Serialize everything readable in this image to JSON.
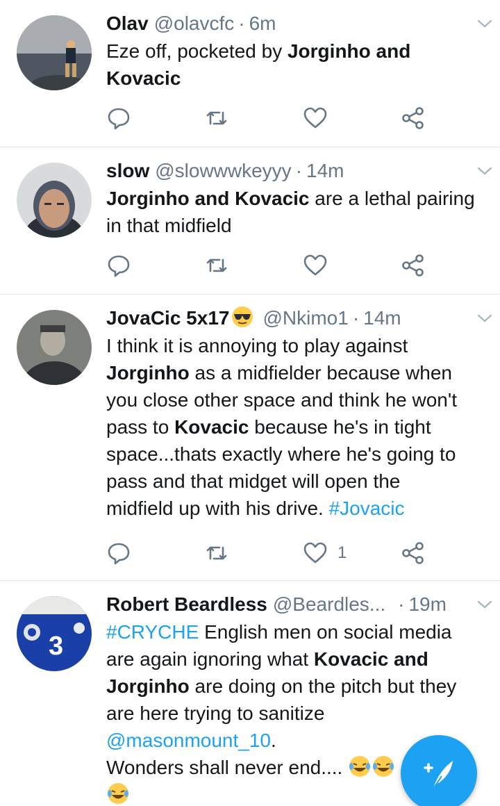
{
  "tweets": [
    {
      "name": "Olav",
      "handle": "@olavcfc",
      "dot": "·",
      "time": "6m",
      "lines": [
        [
          {
            "t": "Eze off, pocketed by "
          },
          {
            "t": "Jorginho and",
            "b": true
          }
        ],
        [
          {
            "t": "Kovacic",
            "b": true
          }
        ]
      ],
      "likes": ""
    },
    {
      "name": "slow",
      "handle": "@slowwwkeyyy",
      "dot": "·",
      "time": "14m",
      "lines": [
        [
          {
            "t": "Jorginho and Kovacic",
            "b": true
          },
          {
            "t": " are a lethal pairing"
          }
        ],
        [
          {
            "t": "in that midfield"
          }
        ]
      ],
      "likes": ""
    },
    {
      "name": "JovaCic 5x17",
      "handle": "@Nkimo1",
      "dot": "·",
      "time": "14m",
      "lines": [
        [
          {
            "t": "I think it is annoying to play against"
          }
        ],
        [
          {
            "t": "Jorginho",
            "b": true
          },
          {
            "t": " as a midfielder because when"
          }
        ],
        [
          {
            "t": "you close other space and think he won't"
          }
        ],
        [
          {
            "t": "pass to "
          },
          {
            "t": "Kovacic",
            "b": true
          },
          {
            "t": " because he's in tight"
          }
        ],
        [
          {
            "t": "space...thats exactly where he's going to"
          }
        ],
        [
          {
            "t": "pass and that midget will open the"
          }
        ],
        [
          {
            "t": "midfield up with his drive. "
          },
          {
            "t": "#Jovacic",
            "l": true
          }
        ]
      ],
      "likes": "1"
    },
    {
      "name": "Robert Beardless",
      "handle": "@Beardles...",
      "dot": "·",
      "time": "19m",
      "lines": [
        [
          {
            "t": "#CRYCHE",
            "l": true
          },
          {
            "t": " English men on social media"
          }
        ],
        [
          {
            "t": "are again ignoring what "
          },
          {
            "t": "Kovacic and",
            "b": true
          }
        ],
        [
          {
            "t": "Jorginho",
            "b": true
          },
          {
            "t": " are doing on the pitch but they"
          }
        ],
        [
          {
            "t": "are here trying to sanitize"
          }
        ],
        [
          {
            "t": "@masonmount_10",
            "l": true
          },
          {
            "t": "."
          }
        ],
        [
          {
            "t": "Wonders shall never end.... "
          }
        ]
      ],
      "likes": ""
    }
  ],
  "compose": {
    "icon": "compose-tweet-icon"
  },
  "colors": {
    "accent": "#1da1f2",
    "muted": "#657786",
    "divider": "#e1e8ed"
  }
}
